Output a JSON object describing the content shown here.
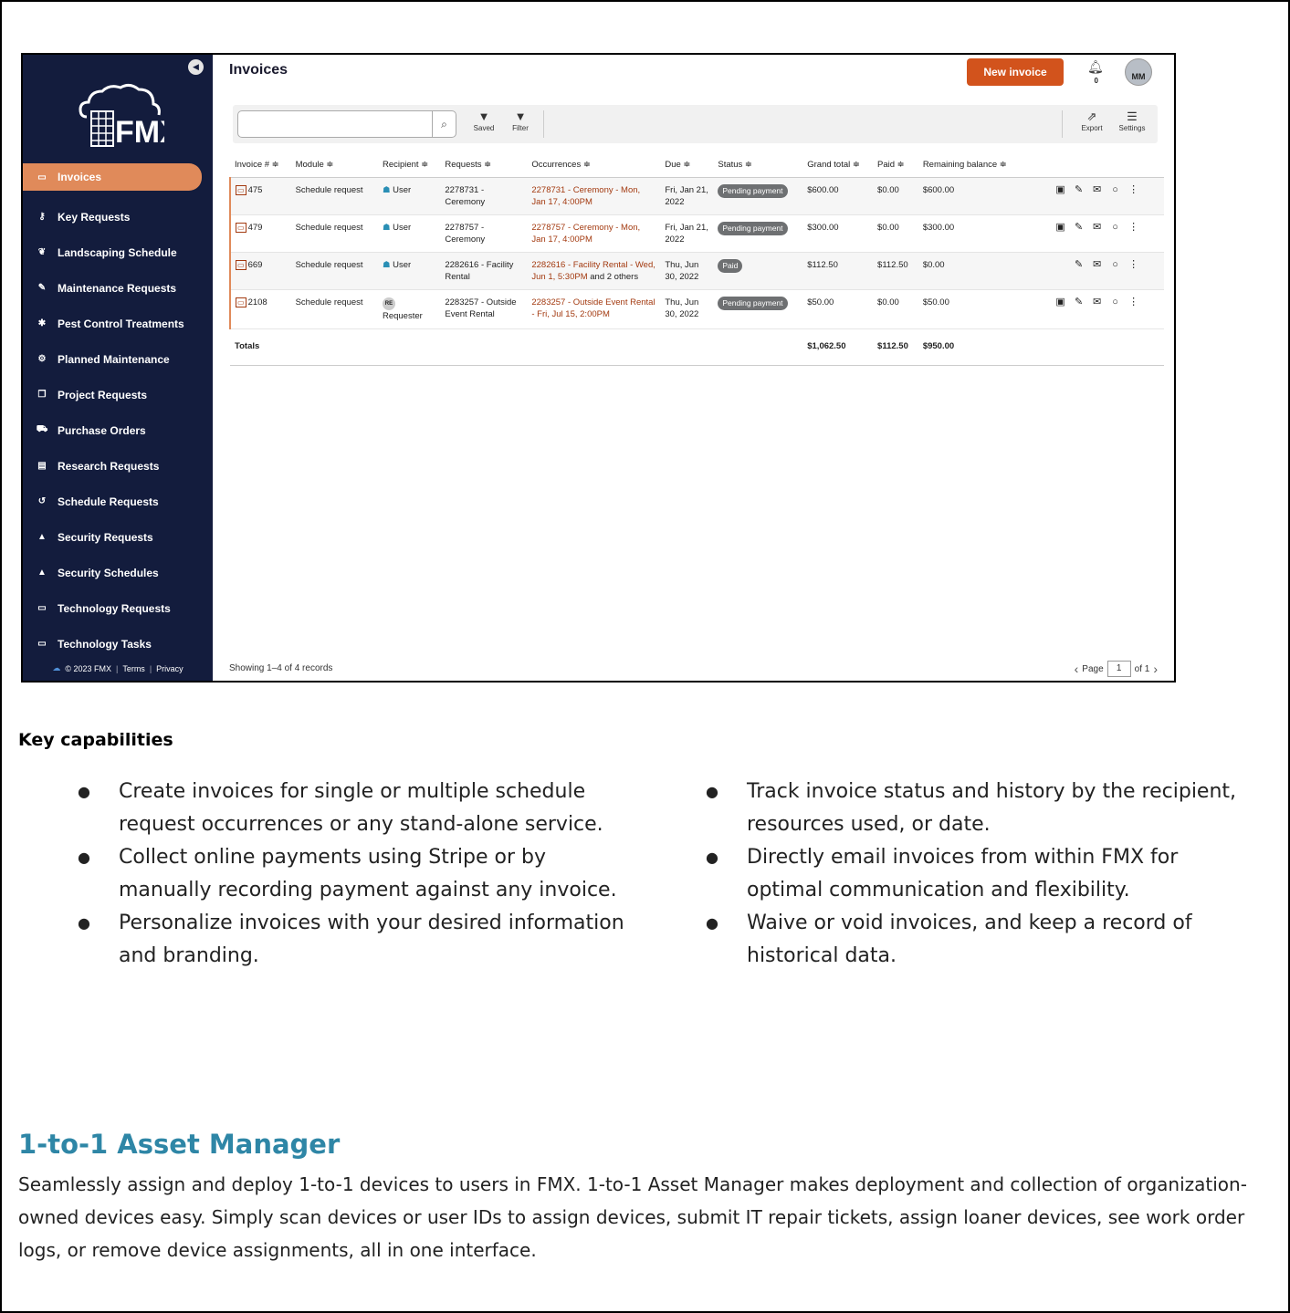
{
  "sidebar": {
    "items": [
      {
        "label": "Invoices",
        "icon": "invoice-icon",
        "glyph": "▭"
      },
      {
        "label": "Key Requests",
        "icon": "key-icon",
        "glyph": "⚷"
      },
      {
        "label": "Landscaping Schedule",
        "icon": "leaf-icon",
        "glyph": "❦"
      },
      {
        "label": "Maintenance Requests",
        "icon": "wrench-icon",
        "glyph": "✎"
      },
      {
        "label": "Pest Control Treatments",
        "icon": "bug-icon",
        "glyph": "✱"
      },
      {
        "label": "Planned Maintenance",
        "icon": "gears-icon",
        "glyph": "⚙"
      },
      {
        "label": "Project Requests",
        "icon": "project-icon",
        "glyph": "❐"
      },
      {
        "label": "Purchase Orders",
        "icon": "cart-icon",
        "glyph": "⛟"
      },
      {
        "label": "Research Requests",
        "icon": "document-icon",
        "glyph": "▤"
      },
      {
        "label": "Schedule Requests",
        "icon": "history-icon",
        "glyph": "↺"
      },
      {
        "label": "Security Requests",
        "icon": "lock-icon",
        "glyph": "▲"
      },
      {
        "label": "Security Schedules",
        "icon": "lock-icon",
        "glyph": "▲"
      },
      {
        "label": "Technology Requests",
        "icon": "laptop-icon",
        "glyph": "▭"
      },
      {
        "label": "Technology Tasks",
        "icon": "laptop-icon",
        "glyph": "▭"
      }
    ],
    "footer": {
      "copyright": "© 2023 FMX",
      "terms": "Terms",
      "privacy": "Privacy"
    }
  },
  "header": {
    "title": "Invoices",
    "new_button": "New invoice",
    "notification_count": "0",
    "avatar_initials": "MM"
  },
  "toolbar": {
    "search_placeholder": "",
    "saved_label": "Saved",
    "filter_label": "Filter",
    "export_label": "Export",
    "settings_label": "Settings"
  },
  "table": {
    "columns": [
      "Invoice # ≑",
      "Module ≑",
      "Recipient ≑",
      "Requests ≑",
      "Occurrences ≑",
      "Due ≑",
      "Status ≑",
      "Grand total ≑",
      "Paid ≑",
      "Remaining balance ≑"
    ],
    "rows": [
      {
        "invoice": "475",
        "module": "Schedule request",
        "recipient": "User",
        "request": "2278731 - Ceremony",
        "occurrence": "2278731 - Ceremony - Mon, Jan 17, 4:00PM",
        "occurrence_extra": "",
        "due": "Fri, Jan 21, 2022",
        "status": "Pending payment",
        "grand_total": "$600.00",
        "paid": "$0.00",
        "remaining": "$600.00"
      },
      {
        "invoice": "479",
        "module": "Schedule request",
        "recipient": "User",
        "request": "2278757 - Ceremony",
        "occurrence": "2278757 - Ceremony - Mon, Jan 17, 4:00PM",
        "occurrence_extra": "",
        "due": "Fri, Jan 21, 2022",
        "status": "Pending payment",
        "grand_total": "$300.00",
        "paid": "$0.00",
        "remaining": "$300.00"
      },
      {
        "invoice": "669",
        "module": "Schedule request",
        "recipient": "User",
        "request": "2282616 - Facility Rental",
        "occurrence": "2282616 - Facility Rental - Wed, Jun 1, 5:30PM",
        "occurrence_extra": "and 2 others",
        "due": "Thu, Jun 30, 2022",
        "status": "Paid",
        "grand_total": "$112.50",
        "paid": "$112.50",
        "remaining": "$0.00"
      },
      {
        "invoice": "2108",
        "module": "Schedule request",
        "recipient": "Requester",
        "recipient_initials": "RE",
        "request": "2283257 - Outside Event Rental",
        "occurrence": "2283257 - Outside Event Rental - Fri, Jul 15, 2:00PM",
        "occurrence_extra": "",
        "due": "Thu, Jun 30, 2022",
        "status": "Pending payment",
        "grand_total": "$50.00",
        "paid": "$0.00",
        "remaining": "$50.00"
      }
    ],
    "totals": {
      "label": "Totals",
      "grand_total": "$1,062.50",
      "paid": "$112.50",
      "remaining": "$950.00"
    }
  },
  "footer": {
    "showing": "Showing 1–4 of 4 records",
    "page_label": "Page",
    "page_value": "1",
    "page_of": "of 1"
  },
  "doc": {
    "caps_title": "Key capabilities",
    "left_bullets": [
      "Create invoices for single or multiple schedule request occurrences or any stand-alone service.",
      "Collect online payments using Stripe or by manually recording payment against any invoice.",
      "Personalize invoices with your desired information and branding."
    ],
    "right_bullets": [
      "Track invoice status and history by the recipient, resources used, or date.",
      "Directly email invoices from within FMX for optimal communication and flexibility.",
      "Waive or void invoices, and keep a record of historical data."
    ],
    "asset_title": "1-to-1 Asset Manager",
    "asset_body": "Seamlessly assign and deploy 1-to-1 devices to users in FMX. 1-to-1 Asset Manager makes deployment and collection of organization-owned devices easy. Simply scan devices or user IDs to assign devices, submit IT repair tickets, assign loaner devices, see work order logs, or remove device assignments, all in one interface."
  },
  "colors": {
    "sidebar_bg": "#131c3d",
    "active_nav": "#e08a5a",
    "primary_button": "#d2531c",
    "link": "#a33a10",
    "heading_teal": "#2e86a6"
  }
}
